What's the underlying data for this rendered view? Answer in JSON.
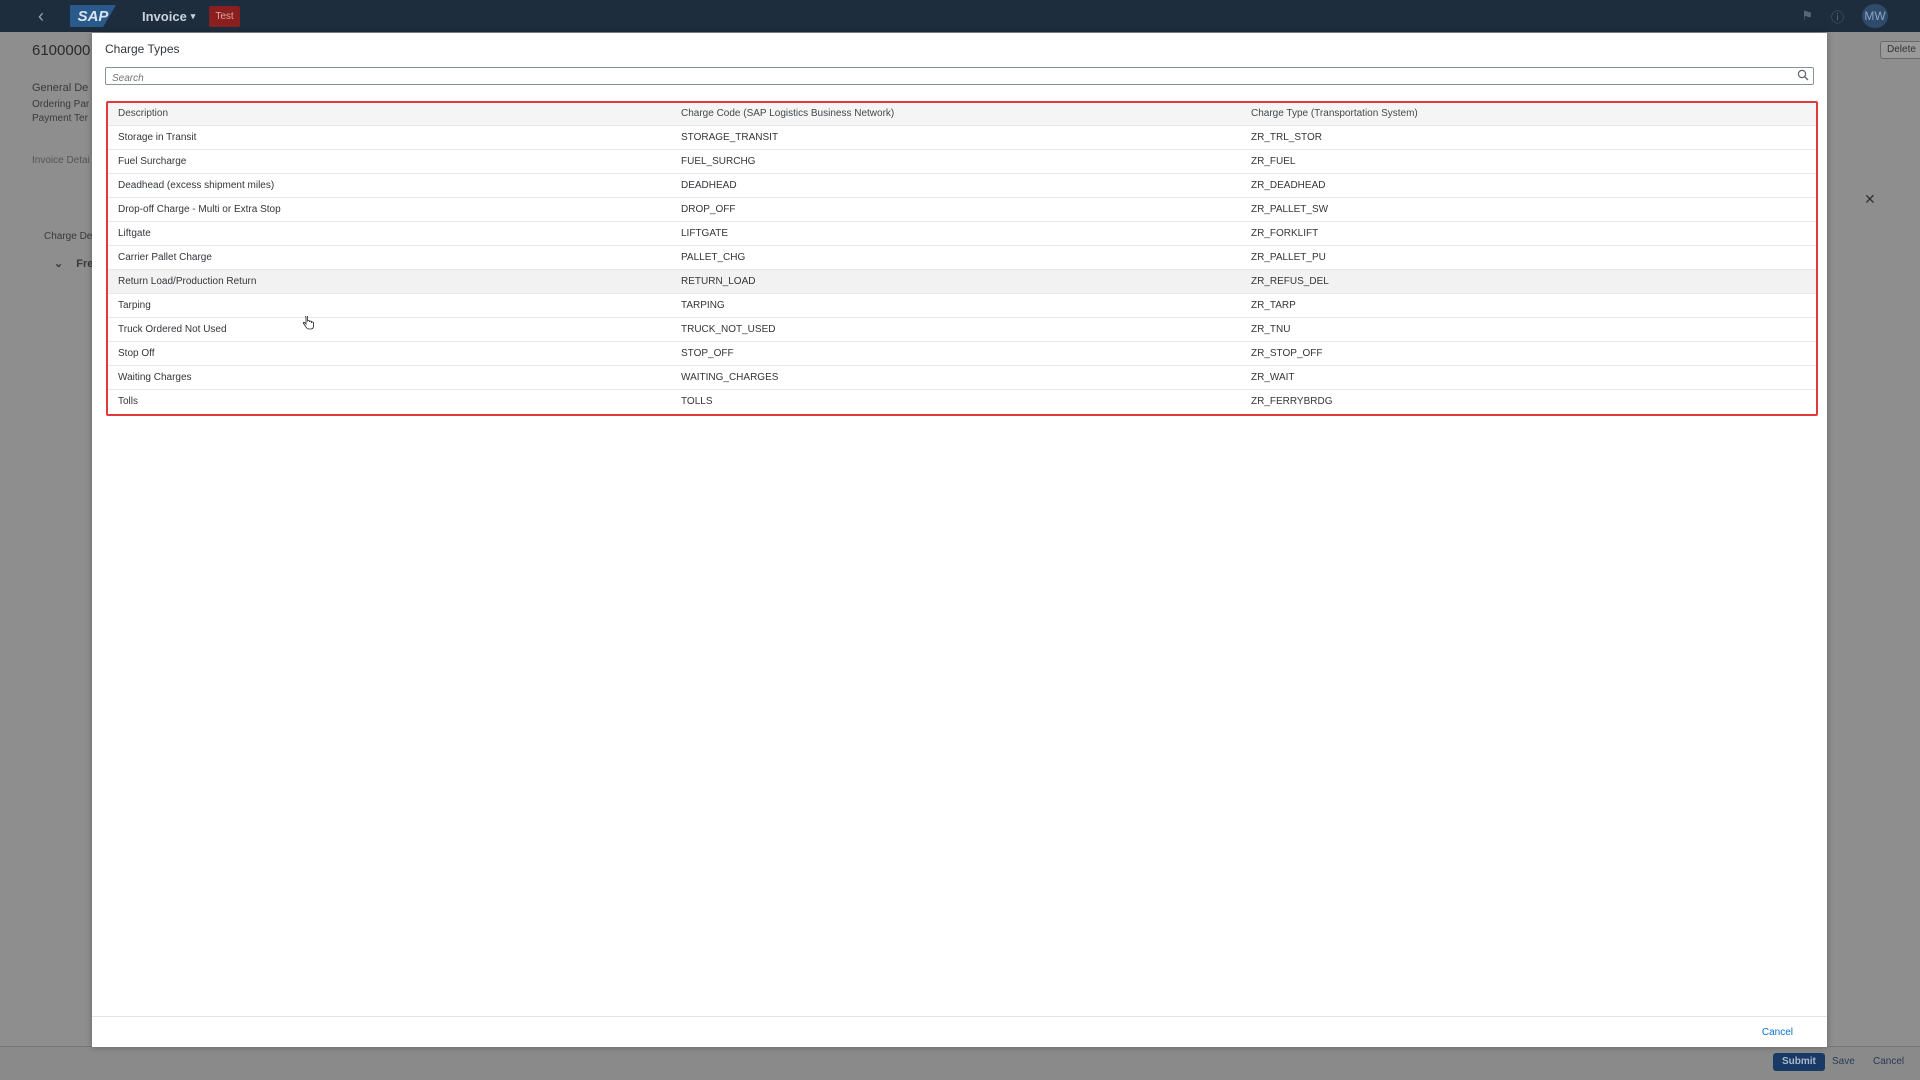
{
  "shell": {
    "app_name": "Invoice",
    "env_tag": "Test",
    "avatar_initials": "MW"
  },
  "background": {
    "page_title": "6100000",
    "general_details": "General De",
    "ordering_party": "Ordering Par",
    "payment_terms": "Payment Ter",
    "invoice_details_tab": "Invoice Detai",
    "charge_details": "Charge De",
    "freight_group": "Freig",
    "delete_button": "Delete"
  },
  "dialog": {
    "title": "Charge Types",
    "search_placeholder": "Search",
    "columns": [
      "Description",
      "Charge Code (SAP Logistics Business Network)",
      "Charge Type (Transportation System)"
    ],
    "rows": [
      {
        "description": "Storage in Transit",
        "code": "STORAGE_TRANSIT",
        "type": "ZR_TRL_STOR"
      },
      {
        "description": "Fuel Surcharge",
        "code": "FUEL_SURCHG",
        "type": "ZR_FUEL"
      },
      {
        "description": "Deadhead (excess shipment miles)",
        "code": "DEADHEAD",
        "type": "ZR_DEADHEAD"
      },
      {
        "description": "Drop-off Charge - Multi or Extra Stop",
        "code": "DROP_OFF",
        "type": "ZR_PALLET_SW"
      },
      {
        "description": "Liftgate",
        "code": "LIFTGATE",
        "type": "ZR_FORKLIFT"
      },
      {
        "description": "Carrier Pallet Charge",
        "code": "PALLET_CHG",
        "type": "ZR_PALLET_PU"
      },
      {
        "description": "Return Load/Production Return",
        "code": "RETURN_LOAD",
        "type": "ZR_REFUS_DEL"
      },
      {
        "description": "Tarping",
        "code": "TARPING",
        "type": "ZR_TARP"
      },
      {
        "description": "Truck Ordered Not Used",
        "code": "TRUCK_NOT_USED",
        "type": "ZR_TNU"
      },
      {
        "description": "Stop Off",
        "code": "STOP_OFF",
        "type": "ZR_STOP_OFF"
      },
      {
        "description": "Waiting Charges",
        "code": "WAITING_CHARGES",
        "type": "ZR_WAIT"
      },
      {
        "description": "Tolls",
        "code": "TOLLS",
        "type": "ZR_FERRYBRDG"
      }
    ],
    "cancel_label": "Cancel"
  },
  "footer": {
    "submit_label": "Submit",
    "save_label": "Save",
    "cancel_label": "Cancel"
  },
  "colors": {
    "shell_bg": "#1d2d3e",
    "highlight_border": "#e4393c",
    "link": "#0a6ed1"
  }
}
